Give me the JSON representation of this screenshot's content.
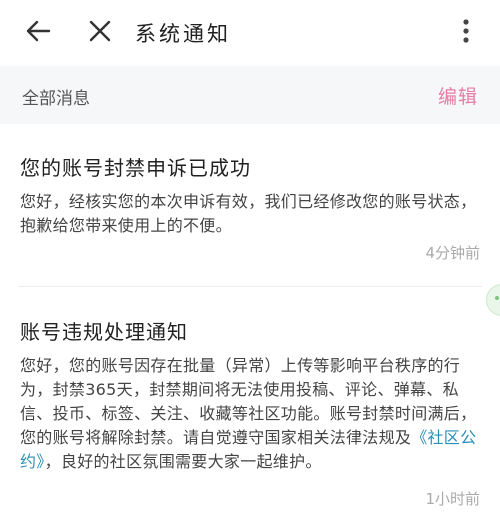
{
  "header": {
    "title": "系统通知",
    "back_icon": "arrow-left-icon",
    "close_icon": "close-icon",
    "more_icon": "more-vertical-icon"
  },
  "subbar": {
    "filter_label": "全部消息",
    "edit_label": "编辑"
  },
  "colors": {
    "accent": "#e77ea4",
    "link": "#2a8fb8",
    "subbar_bg": "#f6f7f9"
  },
  "notices": [
    {
      "title": "您的账号封禁申诉已成功",
      "body": "您好，经核实您的本次申诉有效，我们已经修改您的账号状态，抱歉给您带来使用上的不便。",
      "time": "4分钟前"
    },
    {
      "title": "账号违规处理通知",
      "body_before": "您好，您的账号因存在批量（异常）上传等影响平台秩序的行为，封禁365天，封禁期间将无法使用投稿、评论、弹幕、私信、投币、标签、关注、收藏等社区功能。账号封禁时间满后，您的账号将解除封禁。请自觉遵守国家相关法律法规及",
      "link_text": "《社区公约》",
      "body_after": "，良好的社区氛围需要大家一起维护。",
      "time": "1小时前"
    }
  ]
}
